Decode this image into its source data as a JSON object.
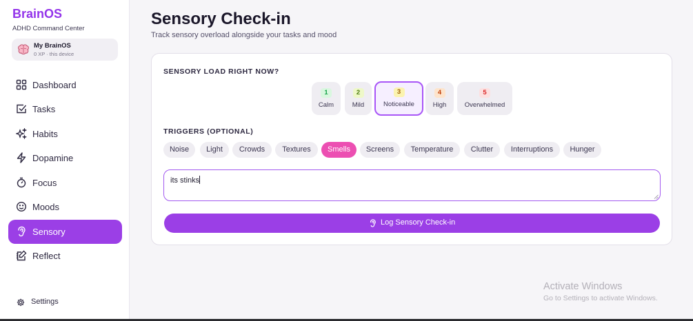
{
  "app": {
    "title": "BrainOS",
    "subtitle": "ADHD Command Center",
    "accent": "#9333ea"
  },
  "profile": {
    "name": "My BrainOS",
    "meta": "0 XP · this device",
    "icon": "brain-icon"
  },
  "sidebar": {
    "items": [
      {
        "label": "Dashboard",
        "icon": "dashboard-grid-icon",
        "active": false
      },
      {
        "label": "Tasks",
        "icon": "checkbox-icon",
        "active": false
      },
      {
        "label": "Habits",
        "icon": "sparkles-icon",
        "active": false
      },
      {
        "label": "Dopamine",
        "icon": "lightning-icon",
        "active": false
      },
      {
        "label": "Focus",
        "icon": "timer-icon",
        "active": false
      },
      {
        "label": "Moods",
        "icon": "smiley-icon",
        "active": false
      },
      {
        "label": "Sensory",
        "icon": "ear-icon",
        "active": true
      },
      {
        "label": "Reflect",
        "icon": "journal-pen-icon",
        "active": false
      }
    ],
    "settings_label": "Settings"
  },
  "page": {
    "title": "Sensory Check-in",
    "subtitle": "Track sensory overload alongside your tasks and mood"
  },
  "load": {
    "label": "SENSORY LOAD RIGHT NOW?",
    "selected": 3,
    "levels": [
      {
        "num": "1",
        "name": "Calm",
        "color": "#16a34a",
        "bg": "#d9f7df"
      },
      {
        "num": "2",
        "name": "Mild",
        "color": "#4d7c0f",
        "bg": "#eef8c8"
      },
      {
        "num": "3",
        "name": "Noticeable",
        "color": "#a16207",
        "bg": "#fbf3b0"
      },
      {
        "num": "4",
        "name": "High",
        "color": "#c2410c",
        "bg": "#fde4cc"
      },
      {
        "num": "5",
        "name": "Overwhelmed",
        "color": "#dc2626",
        "bg": "#fde0e0"
      }
    ]
  },
  "triggers": {
    "label": "TRIGGERS (OPTIONAL)",
    "items": [
      "Noise",
      "Light",
      "Crowds",
      "Textures",
      "Smells",
      "Screens",
      "Temperature",
      "Clutter",
      "Interruptions",
      "Hunger"
    ],
    "selected": [
      "Smells"
    ]
  },
  "note": {
    "value": "its stinks"
  },
  "submit": {
    "label": "Log Sensory Check-in",
    "icon": "ear-icon"
  },
  "watermark": {
    "title": "Activate Windows",
    "subtitle": "Go to Settings to activate Windows."
  }
}
